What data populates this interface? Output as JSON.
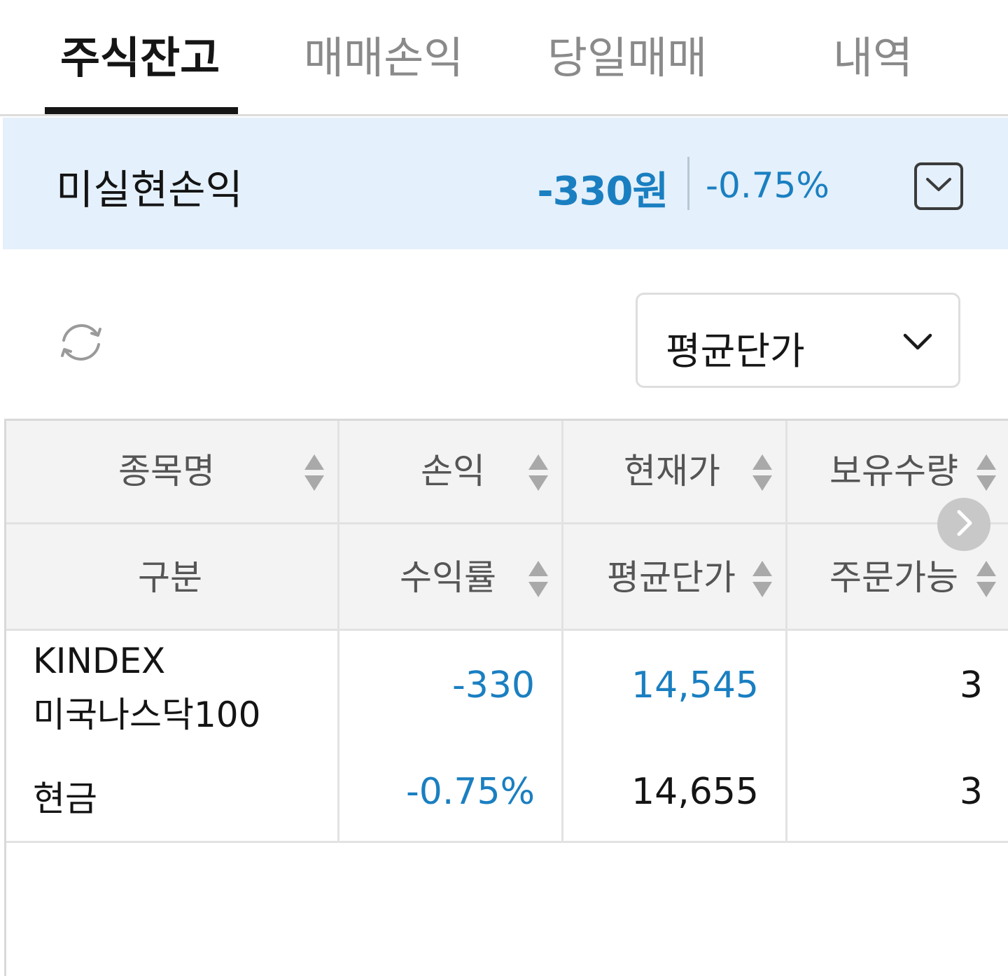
{
  "tabs": [
    {
      "label": "주식잔고",
      "active": true
    },
    {
      "label": "매매손익",
      "active": false
    },
    {
      "label": "당일매매",
      "active": false
    },
    {
      "label": "내역",
      "active": false
    }
  ],
  "summary": {
    "label": "미실현손익",
    "amount": "-330원",
    "rate": "-0.75%",
    "accent_color": "#1a7fc1",
    "background_color": "#e4f0fb"
  },
  "controls": {
    "refresh_icon": "refresh-icon",
    "price_select": {
      "selected": "평균단가"
    }
  },
  "table": {
    "headers_row1": [
      "종목명",
      "손익",
      "현재가",
      "보유수량"
    ],
    "headers_row2": [
      "구분",
      "수익률",
      "평균단가",
      "주문가능"
    ],
    "rows": [
      {
        "name_line1": "KINDEX",
        "name_line2": "미국나스닥100",
        "category": "현금",
        "pnl": "-330",
        "return_rate": "-0.75%",
        "current_price": "14,545",
        "avg_price": "14,655",
        "quantity": "3",
        "orderable": "3"
      }
    ]
  }
}
